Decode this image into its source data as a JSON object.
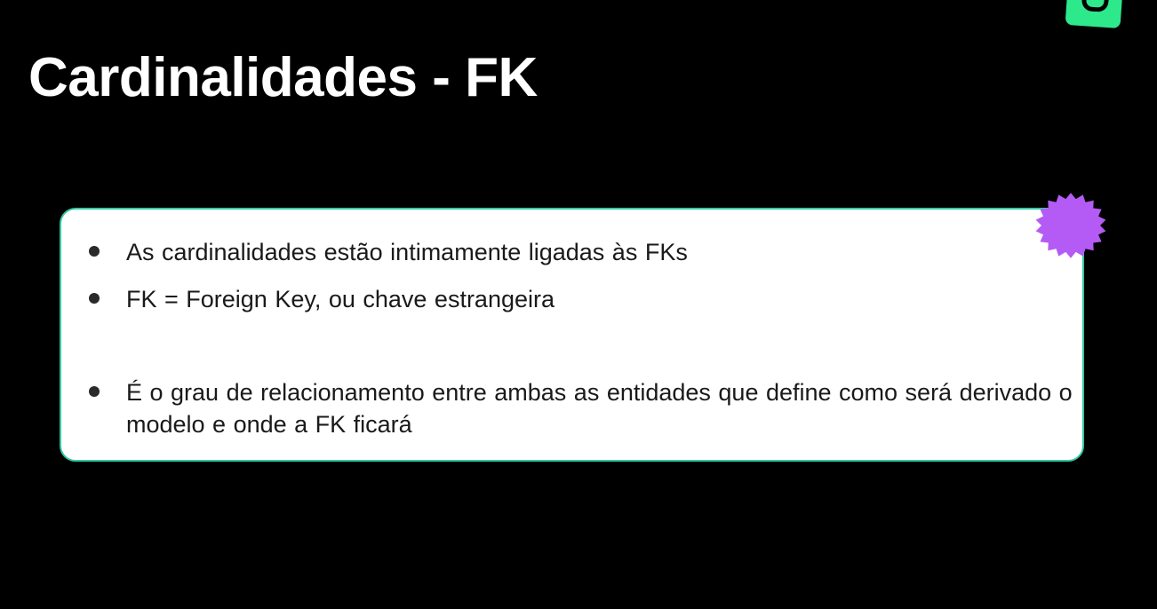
{
  "slide": {
    "title": "Cardinalidades - FK",
    "bullets": [
      "As cardinalidades estão intimamente ligadas às FKs",
      "FK = Foreign Key, ou chave estrangeira",
      "É o grau de relacionamento entre ambas as entidades que define como será derivado o modelo e onde a FK ficará"
    ]
  },
  "colors": {
    "background": "#000000",
    "title": "#ffffff",
    "card_background": "#ffffff",
    "card_border": "#2ec9a4",
    "starburst": "#b45bf5",
    "logo": "#2ee88c"
  },
  "icons": {
    "logo": "brand-logo-icon",
    "starburst": "starburst-icon",
    "bullet": "bullet-dot-icon"
  }
}
